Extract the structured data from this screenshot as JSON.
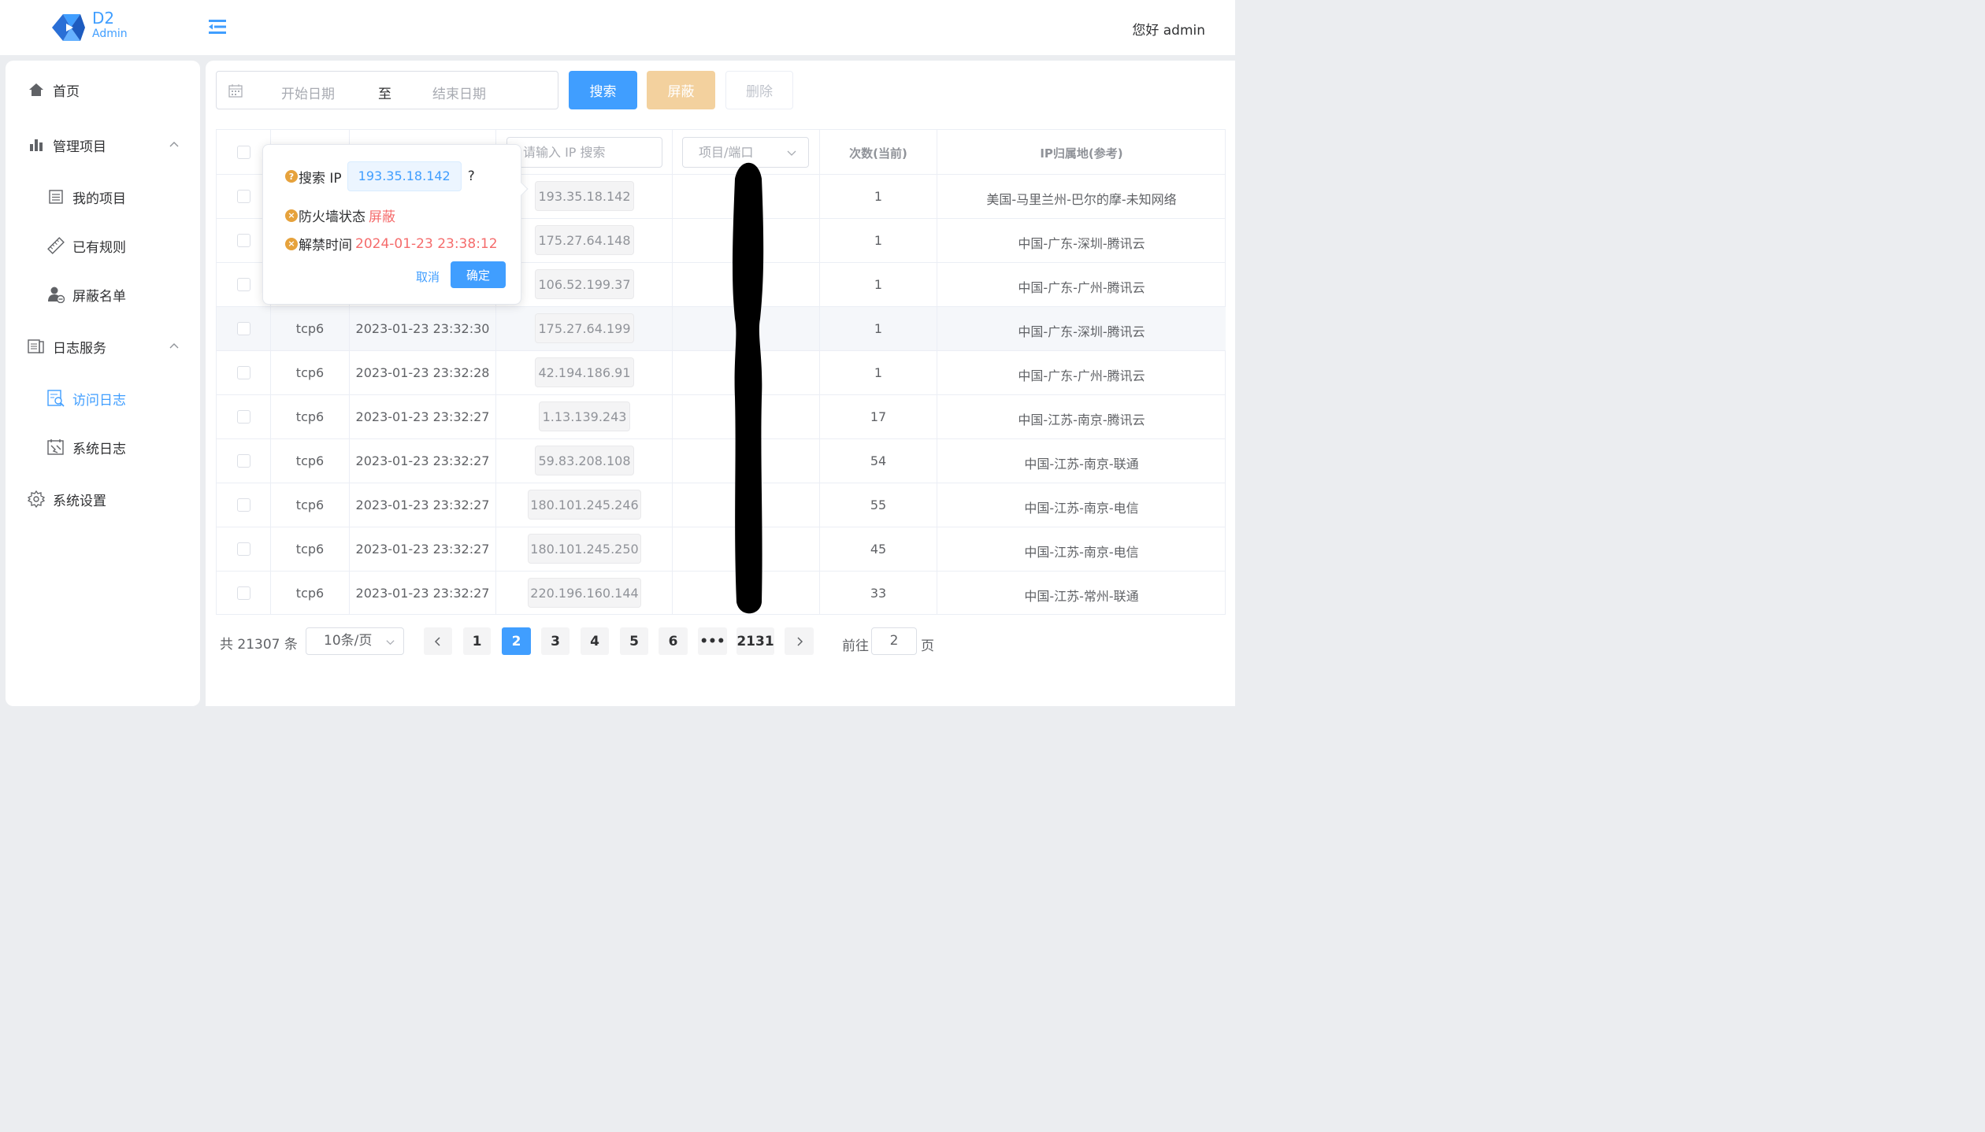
{
  "header": {
    "logo_title": "D2",
    "logo_subtitle": "Admin",
    "greeting": "您好 admin"
  },
  "sidebar": {
    "items": [
      {
        "label": "首页",
        "icon": "home-icon"
      },
      {
        "label": "管理项目",
        "icon": "bar-chart-icon",
        "expanded": true
      },
      {
        "label": "我的项目",
        "icon": "list-doc-icon"
      },
      {
        "label": "已有规则",
        "icon": "ruler-icon"
      },
      {
        "label": "屏蔽名单",
        "icon": "user-block-icon"
      },
      {
        "label": "日志服务",
        "icon": "log-book-icon",
        "expanded": true
      },
      {
        "label": "访问日志",
        "icon": "access-log-icon",
        "active": true
      },
      {
        "label": "系统日志",
        "icon": "system-log-icon"
      },
      {
        "label": "系统设置",
        "icon": "gear-icon"
      }
    ]
  },
  "toolbar": {
    "start_placeholder": "开始日期",
    "range_separator": "至",
    "end_placeholder": "结束日期",
    "search_label": "搜索",
    "block_label": "屏蔽",
    "delete_label": "删除"
  },
  "table": {
    "ip_search_placeholder": "请输入 IP 搜索",
    "project_placeholder": "项目/端口",
    "headers": {
      "count": "次数(当前)",
      "location": "IP归属地(参考)"
    },
    "rows": [
      {
        "protocol": "",
        "time": "",
        "ip": "193.35.18.142",
        "count": "1",
        "location": "美国-马里兰州-巴尔的摩-未知网络"
      },
      {
        "protocol": "",
        "time": "",
        "ip": "175.27.64.148",
        "count": "1",
        "location": "中国-广东-深圳-腾讯云"
      },
      {
        "protocol": "",
        "time": "",
        "ip": "106.52.199.37",
        "count": "1",
        "location": "中国-广东-广州-腾讯云"
      },
      {
        "protocol": "tcp6",
        "time": "2023-01-23 23:32:30",
        "ip": "175.27.64.199",
        "count": "1",
        "location": "中国-广东-深圳-腾讯云"
      },
      {
        "protocol": "tcp6",
        "time": "2023-01-23 23:32:28",
        "ip": "42.194.186.91",
        "count": "1",
        "location": "中国-广东-广州-腾讯云"
      },
      {
        "protocol": "tcp6",
        "time": "2023-01-23 23:32:27",
        "ip": "1.13.139.243",
        "count": "17",
        "location": "中国-江苏-南京-腾讯云"
      },
      {
        "protocol": "tcp6",
        "time": "2023-01-23 23:32:27",
        "ip": "59.83.208.108",
        "count": "54",
        "location": "中国-江苏-南京-联通"
      },
      {
        "protocol": "tcp6",
        "time": "2023-01-23 23:32:27",
        "ip": "180.101.245.246",
        "count": "55",
        "location": "中国-江苏-南京-电信"
      },
      {
        "protocol": "tcp6",
        "time": "2023-01-23 23:32:27",
        "ip": "180.101.245.250",
        "count": "45",
        "location": "中国-江苏-南京-电信"
      },
      {
        "protocol": "tcp6",
        "time": "2023-01-23 23:32:27",
        "ip": "220.196.160.144",
        "count": "33",
        "location": "中国-江苏-常州-联通"
      }
    ]
  },
  "popconfirm": {
    "search_label": "搜索 IP",
    "ip": "193.35.18.142",
    "question_mark": "?",
    "firewall_label": "防火墙状态",
    "firewall_value": "屏蔽",
    "unban_label": "解禁时间",
    "unban_value": "2024-01-23 23:38:12",
    "cancel_label": "取消",
    "confirm_label": "确定"
  },
  "pagination": {
    "total_text": "共 21307 条",
    "page_size": "10条/页",
    "pages": [
      "1",
      "2",
      "3",
      "4",
      "5",
      "6",
      "•••",
      "2131"
    ],
    "current_page": "2",
    "goto_label": "前往",
    "goto_value": "2",
    "page_suffix": "页"
  },
  "colors": {
    "primary": "#409eff",
    "warning_light": "#f3d19e",
    "danger": "#f56c6c",
    "warning": "#e6a23c"
  }
}
